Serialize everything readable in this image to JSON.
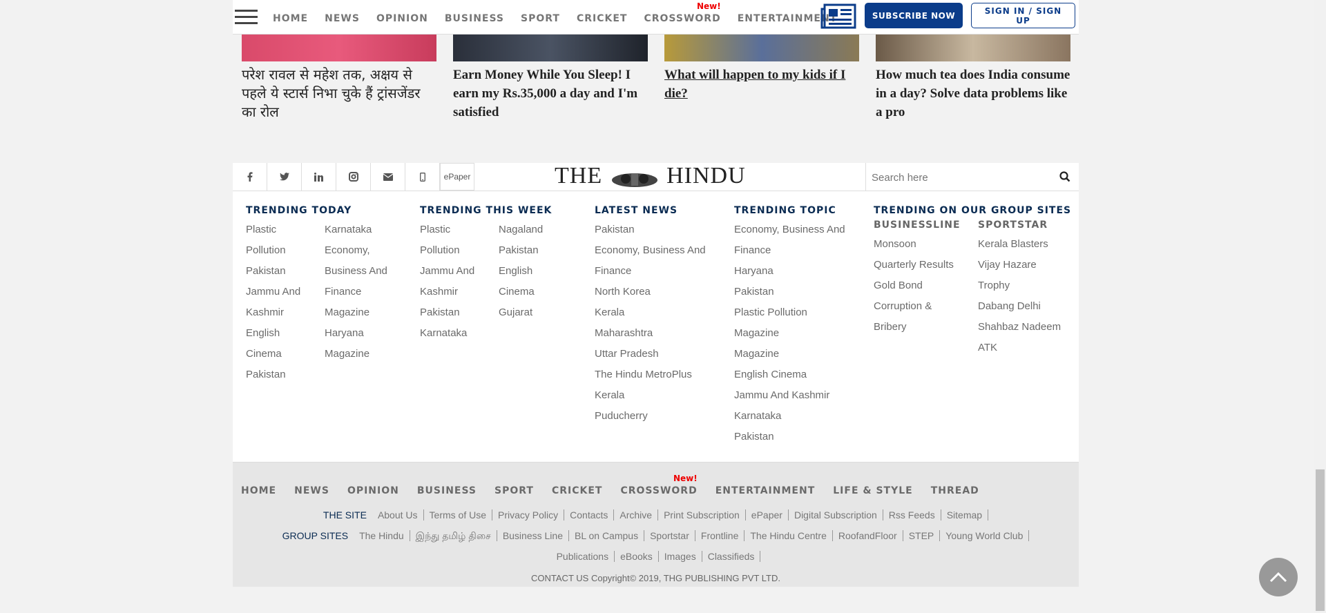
{
  "nav": {
    "items": [
      "HOME",
      "NEWS",
      "OPINION",
      "BUSINESS",
      "SPORT",
      "CRICKET",
      "CROSSWORD",
      "ENTERTAINMENT"
    ],
    "new_badge": "New!",
    "subscribe": "SUBSCRIBE NOW",
    "signin": "SIGN IN / SIGN UP"
  },
  "stories": [
    {
      "title": "परेश रावल से महेश तक, अक्षय से पहले ये स्टार्स निभा चुके हैं ट्रांसजेंडर का रोल"
    },
    {
      "title": "Earn Money While You Sleep! I earn my Rs.35,000 a day and I'm satisfied"
    },
    {
      "title": "What will happen to my kids if I die?"
    },
    {
      "title": "How much tea does India consume in a day? Solve data problems like a pro"
    }
  ],
  "footer": {
    "epaper": "ePaper",
    "logo_left": "THE",
    "logo_right": "HINDU",
    "search_placeholder": "Search here",
    "trending_today": {
      "heading": "TRENDING TODAY",
      "col1": [
        "Plastic",
        "Pollution",
        "Pakistan",
        "Jammu And",
        "Kashmir",
        "English",
        "Cinema",
        "Pakistan"
      ],
      "col2": [
        "Karnataka",
        "Economy,",
        "Business And",
        "Finance",
        "Magazine",
        "Haryana",
        "Magazine"
      ]
    },
    "trending_week": {
      "heading": "TRENDING THIS WEEK",
      "col1": [
        "Plastic",
        "Pollution",
        "Jammu And",
        "Kashmir",
        "Pakistan",
        "Karnataka"
      ],
      "col2": [
        "Nagaland",
        "Pakistan",
        "English",
        "Cinema",
        "Gujarat"
      ]
    },
    "latest_news": {
      "heading": "LATEST NEWS",
      "items": [
        "Pakistan",
        "Economy, Business And",
        "Finance",
        "North Korea",
        "Kerala",
        "Maharashtra",
        "Uttar Pradesh",
        "The Hindu MetroPlus",
        "Kerala",
        "Puducherry"
      ]
    },
    "trending_topic": {
      "heading": "TRENDING TOPIC",
      "items": [
        "Economy, Business And",
        "Finance",
        "Haryana",
        "Pakistan",
        "Plastic Pollution",
        "Magazine",
        "Magazine",
        "English Cinema",
        "Jammu And Kashmir",
        "Karnataka",
        "Pakistan"
      ]
    },
    "group_sites": {
      "heading": "TRENDING ON OUR GROUP SITES",
      "businessline": {
        "heading": "BUSINESSLINE",
        "items": [
          "Monsoon",
          "Quarterly Results",
          "Gold Bond",
          "Corruption &",
          "Bribery"
        ]
      },
      "sportstar": {
        "heading": "SPORTSTAR",
        "items": [
          "Kerala Blasters",
          "Vijay Hazare",
          "Trophy",
          "Dabang Delhi",
          "Shahbaz Nadeem",
          "ATK"
        ]
      }
    },
    "bottom_nav": [
      "HOME",
      "NEWS",
      "OPINION",
      "BUSINESS",
      "SPORT",
      "CRICKET",
      "CROSSWORD",
      "ENTERTAINMENT",
      "LIFE & STYLE",
      "THREAD"
    ],
    "the_site": {
      "label": "THE SITE",
      "links": [
        "About Us",
        "Terms of Use",
        "Privacy Policy",
        "Contacts",
        "Archive",
        "Print Subscription",
        "ePaper",
        "Digital Subscription",
        "Rss Feeds",
        "Sitemap"
      ]
    },
    "group_sites_row": {
      "label": "GROUP SITES",
      "links": [
        "The Hindu",
        "இந்து தமிழ் திசை",
        "Business Line",
        "BL on Campus",
        "Sportstar",
        "Frontline",
        "The Hindu Centre",
        "RoofandFloor",
        "STEP",
        "Young World Club"
      ],
      "links2": [
        "Publications",
        "eBooks",
        "Images",
        "Classifieds"
      ]
    },
    "contact": "CONTACT US",
    "copyright": "Copyright© 2019, THG PUBLISHING PVT LTD."
  }
}
